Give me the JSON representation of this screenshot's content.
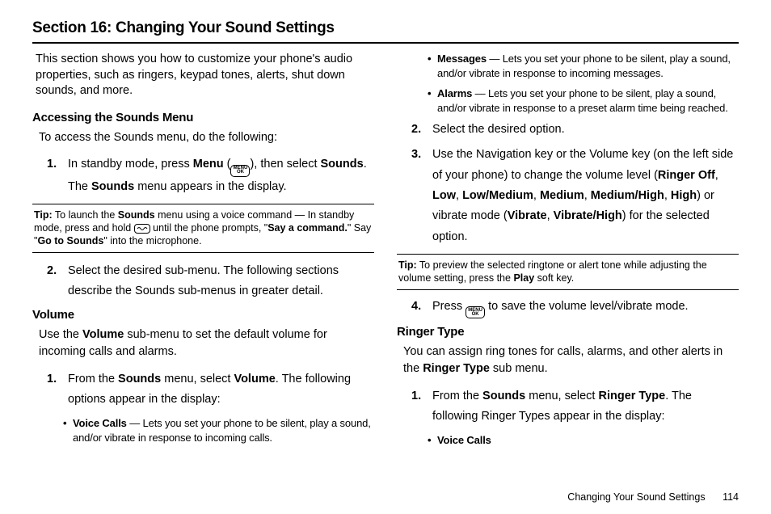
{
  "title": "Section 16: Changing Your Sound Settings",
  "intro": "This section shows you how to customize your phone's audio properties, such as ringers, keypad tones, alerts, shut down sounds, and more.",
  "accessing": {
    "heading": "Accessing the Sounds Menu",
    "lead": "To access the Sounds menu, do the following:",
    "step1": {
      "num": "1.",
      "pre": "In standby mode, press ",
      "menu_b": "Menu",
      "mid": " (",
      "post": "), then select ",
      "sounds_b": "Sounds",
      "end": ". The ",
      "sounds2_b": "Sounds",
      "end2": " menu appears in the display."
    },
    "tip": {
      "label": "Tip:",
      "t1": " To launch the ",
      "b1": "Sounds",
      "t2": " menu using a voice command — In standby mode, press and hold ",
      "t3": " until the phone prompts, \"",
      "b2": "Say a command.",
      "t4": "\" Say \"",
      "b3": "Go to Sounds",
      "t5": "\" into the microphone."
    },
    "step2": {
      "num": "2.",
      "text": "Select the desired sub-menu. The following sections describe the Sounds sub-menus in greater detail."
    }
  },
  "volume": {
    "heading": "Volume",
    "lead_pre": "Use the ",
    "lead_b": "Volume",
    "lead_post": " sub-menu to set the default volume for incoming calls and alarms.",
    "step1": {
      "num": "1.",
      "pre": "From the ",
      "b1": "Sounds",
      "mid": " menu, select ",
      "b2": "Volume",
      "post": ". The following options appear in the display:"
    },
    "voice": {
      "label": "Voice Calls",
      "text": " — Lets you set your phone to be silent, play a sound, and/or vibrate in response to incoming calls."
    },
    "messages": {
      "label": "Messages",
      "text": " — Lets you set your phone to be silent, play a sound, and/or vibrate in response to incoming messages."
    },
    "alarms": {
      "label": "Alarms",
      "text": " — Lets you set your phone to be silent, play a sound, and/or vibrate in response to a preset alarm time being reached."
    },
    "step2": {
      "num": "2.",
      "text": "Select the desired option."
    },
    "step3": {
      "num": "3.",
      "pre": "Use the Navigation key or the Volume key (on the left side of your phone) to change the volume level (",
      "b1": "Ringer Off",
      "c1": ", ",
      "b2": "Low",
      "c2": ", ",
      "b3": "Low/Medium",
      "c3": ", ",
      "b4": "Medium",
      "c4": ", ",
      "b5": "Medium/High",
      "c5": ", ",
      "b6": "High",
      "mid": ") or vibrate mode (",
      "b7": "Vibrate",
      "c6": ", ",
      "b8": "Vibrate/High",
      "post": ") for the selected option."
    },
    "tip": {
      "label": "Tip:",
      "t1": " To preview the selected ringtone or alert tone while adjusting the volume setting, press the ",
      "b1": "Play",
      "t2": " soft key."
    },
    "step4": {
      "num": "4.",
      "pre": "Press ",
      "post": " to save the volume level/vibrate mode."
    }
  },
  "ringer": {
    "heading": "Ringer Type",
    "lead_pre": "You can assign ring tones for calls, alarms, and other alerts in the ",
    "lead_b": "Ringer Type",
    "lead_post": " sub menu.",
    "step1": {
      "num": "1.",
      "pre": "From the ",
      "b1": "Sounds",
      "mid": " menu, select ",
      "b2": "Ringer Type",
      "post": ". The following Ringer Types appear in the display:"
    },
    "voice": {
      "label": "Voice Calls"
    }
  },
  "footer": {
    "text": "Changing Your Sound Settings",
    "page": "114"
  },
  "menukey": {
    "top": "MENU",
    "bot": "OK"
  }
}
